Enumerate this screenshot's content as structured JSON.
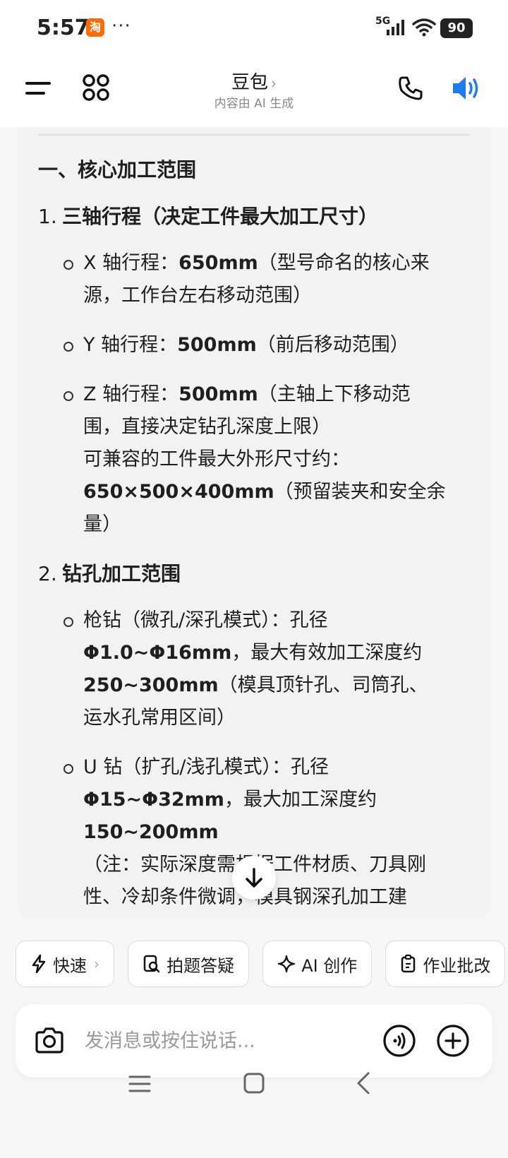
{
  "status_bar": {
    "time": "5:57",
    "app_badge": "淘",
    "more": "···",
    "network": "5G",
    "battery": "90"
  },
  "header": {
    "title": "豆包",
    "title_chevron": "›",
    "subtitle": "内容由 AI 生成"
  },
  "content": {
    "section_title": "一、核心加工范围",
    "items": [
      {
        "num": "1.",
        "title": "三轴行程（决定工件最大加工尺寸）",
        "bullets": [
          {
            "lines": [
              [
                {
                  "t": "X 轴行程："
                },
                {
                  "t": "650mm",
                  "b": true
                },
                {
                  "t": "（型号命名的核心来"
                }
              ],
              [
                {
                  "t": "源，工作台左右移动范围）"
                }
              ]
            ]
          },
          {
            "lines": [
              [
                {
                  "t": "Y 轴行程："
                },
                {
                  "t": "500mm",
                  "b": true
                },
                {
                  "t": "（前后移动范围）"
                }
              ]
            ]
          },
          {
            "lines": [
              [
                {
                  "t": "Z 轴行程："
                },
                {
                  "t": "500mm",
                  "b": true
                },
                {
                  "t": "（主轴上下移动范"
                }
              ],
              [
                {
                  "t": "围，直接决定钻孔深度上限）"
                }
              ],
              [
                {
                  "t": "可兼容的工件最大外形尺寸约："
                }
              ],
              [
                {
                  "t": "650×500×400mm",
                  "b": true
                },
                {
                  "t": "（预留装夹和安全余"
                }
              ],
              [
                {
                  "t": "量）"
                }
              ]
            ]
          }
        ]
      },
      {
        "num": "2.",
        "title": "钻孔加工范围",
        "bullets": [
          {
            "lines": [
              [
                {
                  "t": "枪钻（微孔/深孔模式）：孔径"
                }
              ],
              [
                {
                  "t": "Φ1.0~Φ16mm",
                  "b": true
                },
                {
                  "t": "，最大有效加工深度约"
                }
              ],
              [
                {
                  "t": "250~300mm",
                  "b": true
                },
                {
                  "t": "（模具顶针孔、司筒孔、"
                }
              ],
              [
                {
                  "t": "运水孔常用区间）"
                }
              ]
            ]
          },
          {
            "lines": [
              [
                {
                  "t": "U 钻（扩孔/浅孔模式）：孔径"
                }
              ],
              [
                {
                  "t": "Φ15~Φ32mm",
                  "b": true
                },
                {
                  "t": "，最大加工深度约"
                }
              ],
              [
                {
                  "t": "150~200mm",
                  "b": true
                }
              ],
              [
                {
                  "t": "（注：实际深度需根据工件材质、刀具刚"
                }
              ],
              [
                {
                  "t": "性、冷却条件微调，模具钢深孔加工建"
                }
              ]
            ]
          }
        ]
      }
    ]
  },
  "chips": [
    {
      "label": "快速",
      "icon": "lightning-icon",
      "chevron": "›"
    },
    {
      "label": "拍题答疑",
      "icon": "photo-search-icon"
    },
    {
      "label": "AI 创作",
      "icon": "sparkle-icon"
    },
    {
      "label": "作业批改",
      "icon": "clipboard-icon"
    }
  ],
  "input": {
    "placeholder": "发消息或按住说话..."
  },
  "colors": {
    "accent": "#1f7cf0",
    "background": "#f7f7f8",
    "card": "#f2f2f4"
  }
}
